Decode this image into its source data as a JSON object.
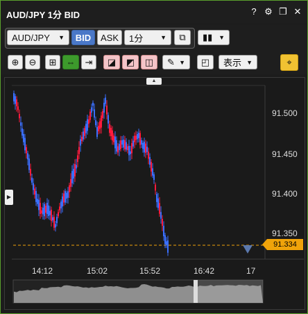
{
  "title": "AUD/JPY 1分 BID",
  "titlebar_icons": [
    "close-icon-x",
    "help-icon",
    "settings-icon",
    "restore-icon",
    "close-icon"
  ],
  "toolbar": {
    "symbol": "AUD/JPY",
    "bid_label": "BID",
    "ask_label": "ASK",
    "timeframe": "1分",
    "display_label": "表示"
  },
  "chart_data": {
    "type": "candlestick",
    "y_ticks": [
      "91.500",
      "91.450",
      "91.400",
      "91.350"
    ],
    "x_ticks": [
      "14:12",
      "15:02",
      "15:52",
      "16:42",
      "17"
    ],
    "current_price": "91.334",
    "ylim": [
      91.33,
      91.53
    ]
  },
  "colors": {
    "up": "#ff1a3c",
    "down": "#3a6fff",
    "accent": "#f0a30a",
    "frame": "#5aa02c"
  }
}
